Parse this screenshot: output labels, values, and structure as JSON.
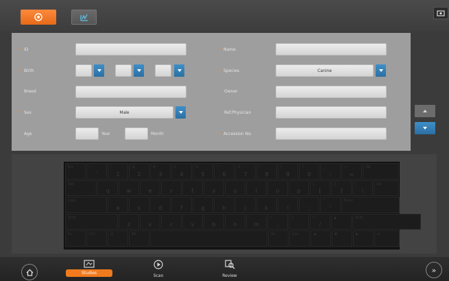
{
  "toolbar": {
    "new_patient_icon": "add-icon",
    "worklist_icon": "worklist-icon",
    "corner_icon": "screen-icon"
  },
  "form": {
    "id_label": "ID",
    "name_label": "Name",
    "birth_label": "Birth",
    "species_label": "Species",
    "species_value": "Canine",
    "breed_label": "Breed",
    "owner_label": "Owner",
    "sex_label": "Sex",
    "sex_value": "Male",
    "ref_physician_label": "Ref.Physician",
    "age_label": "Age",
    "year_label": "Year",
    "month_label": "Month",
    "accession_label": "Accession No."
  },
  "keyboard": {
    "row1": [
      [
        "Esc",
        ""
      ],
      [
        "~",
        "`"
      ],
      [
        "!",
        "1"
      ],
      [
        "@",
        "2"
      ],
      [
        "#",
        "3"
      ],
      [
        "$",
        "4"
      ],
      [
        "%",
        "5"
      ],
      [
        "^",
        "6"
      ],
      [
        "&",
        "7"
      ],
      [
        "*",
        "8"
      ],
      [
        "(",
        "9"
      ],
      [
        ")",
        "0"
      ],
      [
        "_",
        "-"
      ],
      [
        "+",
        "="
      ],
      [
        "⌫",
        ""
      ]
    ],
    "row2": [
      [
        "Tab",
        ""
      ],
      [
        "",
        "q"
      ],
      [
        "",
        "w"
      ],
      [
        "",
        "e"
      ],
      [
        "",
        "r"
      ],
      [
        "",
        "t"
      ],
      [
        "",
        "y"
      ],
      [
        "",
        "u"
      ],
      [
        "",
        "i"
      ],
      [
        "",
        "o"
      ],
      [
        "",
        "p"
      ],
      [
        "{",
        "["
      ],
      [
        "}",
        "]"
      ],
      [
        "|",
        "\\"
      ],
      [
        "Del",
        ""
      ]
    ],
    "row3": [
      [
        "Caps",
        ""
      ],
      [
        "",
        "a"
      ],
      [
        "",
        "s"
      ],
      [
        "",
        "d"
      ],
      [
        "",
        "f"
      ],
      [
        "",
        "g"
      ],
      [
        "",
        "h"
      ],
      [
        "",
        "j"
      ],
      [
        "",
        "k"
      ],
      [
        "",
        "l"
      ],
      [
        ":",
        ";"
      ],
      [
        "\"",
        "'"
      ],
      [
        "Enter",
        ""
      ]
    ],
    "row4": [
      [
        "Shift",
        ""
      ],
      [
        "",
        "z"
      ],
      [
        "",
        "x"
      ],
      [
        "",
        "c"
      ],
      [
        "",
        "v"
      ],
      [
        "",
        "b"
      ],
      [
        "",
        "n"
      ],
      [
        "",
        "m"
      ],
      [
        "<",
        ","
      ],
      [
        ">",
        "."
      ],
      [
        "?",
        "/"
      ],
      [
        "▲",
        ""
      ],
      [
        "Shift",
        ""
      ]
    ],
    "row5": [
      [
        "Fn",
        ""
      ],
      [
        "Ctrl",
        ""
      ],
      [
        "⊞",
        ""
      ],
      [
        "Alt",
        ""
      ],
      [
        "",
        ""
      ],
      [
        "Alt",
        ""
      ],
      [
        "Ctrl",
        ""
      ],
      [
        "◀",
        ""
      ],
      [
        "▼",
        ""
      ],
      [
        "▶",
        ""
      ],
      [
        "⊕",
        ""
      ]
    ]
  },
  "bottom": {
    "studies_label": "Studies",
    "scan_label": "Scan",
    "review_label": "Review"
  }
}
